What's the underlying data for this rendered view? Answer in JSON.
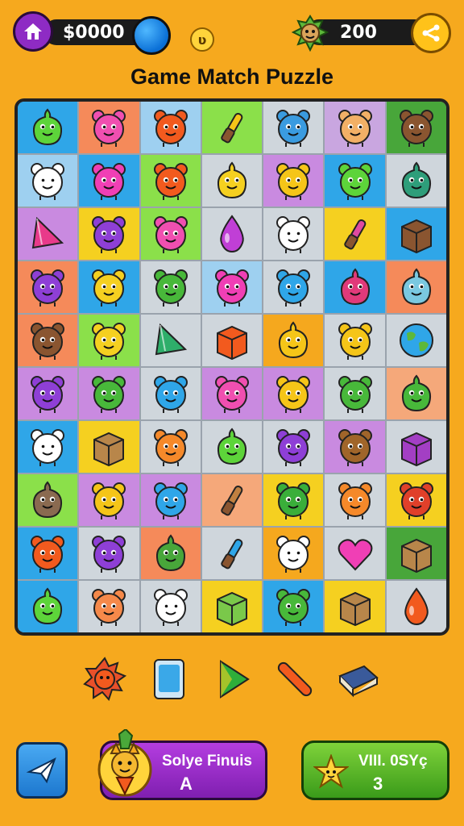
{
  "topbar": {
    "money": "$0000",
    "coin_letter": "ʋ",
    "score": "200"
  },
  "title": "Game Match Puzzle",
  "board": {
    "rows": [
      [
        {
          "bg": "#2FA6E8",
          "fg": "#5DD43A",
          "shape": "blob"
        },
        {
          "bg": "#F58A5A",
          "fg": "#F04FB0",
          "shape": "face"
        },
        {
          "bg": "#9ED0F0",
          "fg": "#F25A1E",
          "shape": "face"
        },
        {
          "bg": "#8BE04A",
          "fg": "#F5C518",
          "shape": "tool"
        },
        {
          "bg": "#CFD6DC",
          "fg": "#3A9BE0",
          "shape": "face"
        },
        {
          "bg": "#C9A6E0",
          "fg": "#F2B066",
          "shape": "face"
        },
        {
          "bg": "#48A63A",
          "fg": "#8A5530",
          "shape": "face"
        }
      ],
      [
        {
          "bg": "#9ED0F0",
          "fg": "#FFFFFF",
          "shape": "face"
        },
        {
          "bg": "#2FA6E8",
          "fg": "#F03FB5",
          "shape": "face"
        },
        {
          "bg": "#8BE04A",
          "fg": "#F25A1E",
          "shape": "face"
        },
        {
          "bg": "#CFD6DC",
          "fg": "#F5D020",
          "shape": "blob"
        },
        {
          "bg": "#C98AE0",
          "fg": "#F5C518",
          "shape": "face"
        },
        {
          "bg": "#2FA6E8",
          "fg": "#5DD43A",
          "shape": "face"
        },
        {
          "bg": "#CFD6DC",
          "fg": "#2E9E7A",
          "shape": "blob"
        }
      ],
      [
        {
          "bg": "#C98AE0",
          "fg": "#E83A8A",
          "shape": "tri"
        },
        {
          "bg": "#F5D020",
          "fg": "#8E3FD6",
          "shape": "face"
        },
        {
          "bg": "#8BE04A",
          "fg": "#F04FB0",
          "shape": "face"
        },
        {
          "bg": "#CFD6DC",
          "fg": "#C03FD6",
          "shape": "drop"
        },
        {
          "bg": "#CFD6DC",
          "fg": "#FFFFFF",
          "shape": "face"
        },
        {
          "bg": "#F5D020",
          "fg": "#E04AA0",
          "shape": "tool"
        },
        {
          "bg": "#2FA6E8",
          "fg": "#8A5530",
          "shape": "box"
        }
      ],
      [
        {
          "bg": "#F58A5A",
          "fg": "#8E3FD6",
          "shape": "face"
        },
        {
          "bg": "#2FA6E8",
          "fg": "#F5D020",
          "shape": "face"
        },
        {
          "bg": "#CFD6DC",
          "fg": "#48B83A",
          "shape": "face"
        },
        {
          "bg": "#9ED0F0",
          "fg": "#F03FB5",
          "shape": "face"
        },
        {
          "bg": "#CFD6DC",
          "fg": "#2FA6E8",
          "shape": "face"
        },
        {
          "bg": "#2FA6E8",
          "fg": "#E03A7A",
          "shape": "blob"
        },
        {
          "bg": "#F58A5A",
          "fg": "#7AC8E0",
          "shape": "blob"
        }
      ],
      [
        {
          "bg": "#F58A5A",
          "fg": "#8A5530",
          "shape": "face"
        },
        {
          "bg": "#8BE04A",
          "fg": "#F5D020",
          "shape": "face"
        },
        {
          "bg": "#CFD6DC",
          "fg": "#2EAE6A",
          "shape": "tri"
        },
        {
          "bg": "#CFD6DC",
          "fg": "#F25A1E",
          "shape": "box"
        },
        {
          "bg": "#F5A81E",
          "fg": "#F5C518",
          "shape": "blob"
        },
        {
          "bg": "#CFD6DC",
          "fg": "#F5C518",
          "shape": "face"
        },
        {
          "bg": "#CFD6DC",
          "fg": "#2FA6E8",
          "shape": "globe"
        }
      ],
      [
        {
          "bg": "#C98AE0",
          "fg": "#8E3FD6",
          "shape": "face"
        },
        {
          "bg": "#C98AE0",
          "fg": "#48B83A",
          "shape": "face"
        },
        {
          "bg": "#CFD6DC",
          "fg": "#2FA6E8",
          "shape": "face"
        },
        {
          "bg": "#C98AE0",
          "fg": "#F04FB0",
          "shape": "face"
        },
        {
          "bg": "#C98AE0",
          "fg": "#F5C518",
          "shape": "face"
        },
        {
          "bg": "#CFD6DC",
          "fg": "#48B83A",
          "shape": "face"
        },
        {
          "bg": "#F5A87A",
          "fg": "#48B83A",
          "shape": "blob"
        }
      ],
      [
        {
          "bg": "#2FA6E8",
          "fg": "#FFFFFF",
          "shape": "face"
        },
        {
          "bg": "#F5D020",
          "fg": "#B8864A",
          "shape": "box"
        },
        {
          "bg": "#CFD6DC",
          "fg": "#F5892A",
          "shape": "face"
        },
        {
          "bg": "#CFD6DC",
          "fg": "#5DD43A",
          "shape": "blob"
        },
        {
          "bg": "#CFD6DC",
          "fg": "#8E3FD6",
          "shape": "face"
        },
        {
          "bg": "#C98AE0",
          "fg": "#A0652A",
          "shape": "face"
        },
        {
          "bg": "#CFD6DC",
          "fg": "#A33FC4",
          "shape": "box"
        }
      ],
      [
        {
          "bg": "#8BE04A",
          "fg": "#8A6A50",
          "shape": "blob"
        },
        {
          "bg": "#C98AE0",
          "fg": "#F5C518",
          "shape": "face"
        },
        {
          "bg": "#C98AE0",
          "fg": "#2FA6E8",
          "shape": "face"
        },
        {
          "bg": "#F5A87A",
          "fg": "#C08040",
          "shape": "tool"
        },
        {
          "bg": "#F5D020",
          "fg": "#3AAE3A",
          "shape": "face"
        },
        {
          "bg": "#CFD6DC",
          "fg": "#F5892A",
          "shape": "face"
        },
        {
          "bg": "#F5D020",
          "fg": "#E0402A",
          "shape": "face"
        }
      ],
      [
        {
          "bg": "#2FA6E8",
          "fg": "#F25A1E",
          "shape": "face"
        },
        {
          "bg": "#CFD6DC",
          "fg": "#8E3FD6",
          "shape": "face"
        },
        {
          "bg": "#F58A5A",
          "fg": "#48A63A",
          "shape": "blob"
        },
        {
          "bg": "#CFD6DC",
          "fg": "#2FA6E8",
          "shape": "tool"
        },
        {
          "bg": "#F5A81E",
          "fg": "#FFFFFF",
          "shape": "face"
        },
        {
          "bg": "#CFD6DC",
          "fg": "#F03FB5",
          "shape": "heart"
        },
        {
          "bg": "#48A63A",
          "fg": "#B8864A",
          "shape": "box"
        }
      ],
      [
        {
          "bg": "#2FA6E8",
          "fg": "#5DD43A",
          "shape": "blob"
        },
        {
          "bg": "#CFD6DC",
          "fg": "#F5894A",
          "shape": "face"
        },
        {
          "bg": "#CFD6DC",
          "fg": "#FFFFFF",
          "shape": "face"
        },
        {
          "bg": "#F5D020",
          "fg": "#7AC84A",
          "shape": "box"
        },
        {
          "bg": "#2FA6E8",
          "fg": "#48B83A",
          "shape": "face"
        },
        {
          "bg": "#F5D020",
          "fg": "#B8864A",
          "shape": "box"
        },
        {
          "bg": "#CFD6DC",
          "fg": "#F25A1E",
          "shape": "drop"
        }
      ]
    ]
  },
  "tray": [
    {
      "name": "orange-spiky-icon",
      "color": "#E8502A"
    },
    {
      "name": "blue-card-icon",
      "color": "#3AA8E8"
    },
    {
      "name": "green-triangle-icon",
      "color": "#2EAE3A"
    },
    {
      "name": "orange-stick-icon",
      "color": "#F25A1E"
    },
    {
      "name": "blue-book-icon",
      "color": "#3A5A9A"
    }
  ],
  "buttons": {
    "solve_line1": "Solye Finuis",
    "solve_line2": "A",
    "vill_line1": "VIII. 0SYç",
    "vill_line2": "3"
  }
}
